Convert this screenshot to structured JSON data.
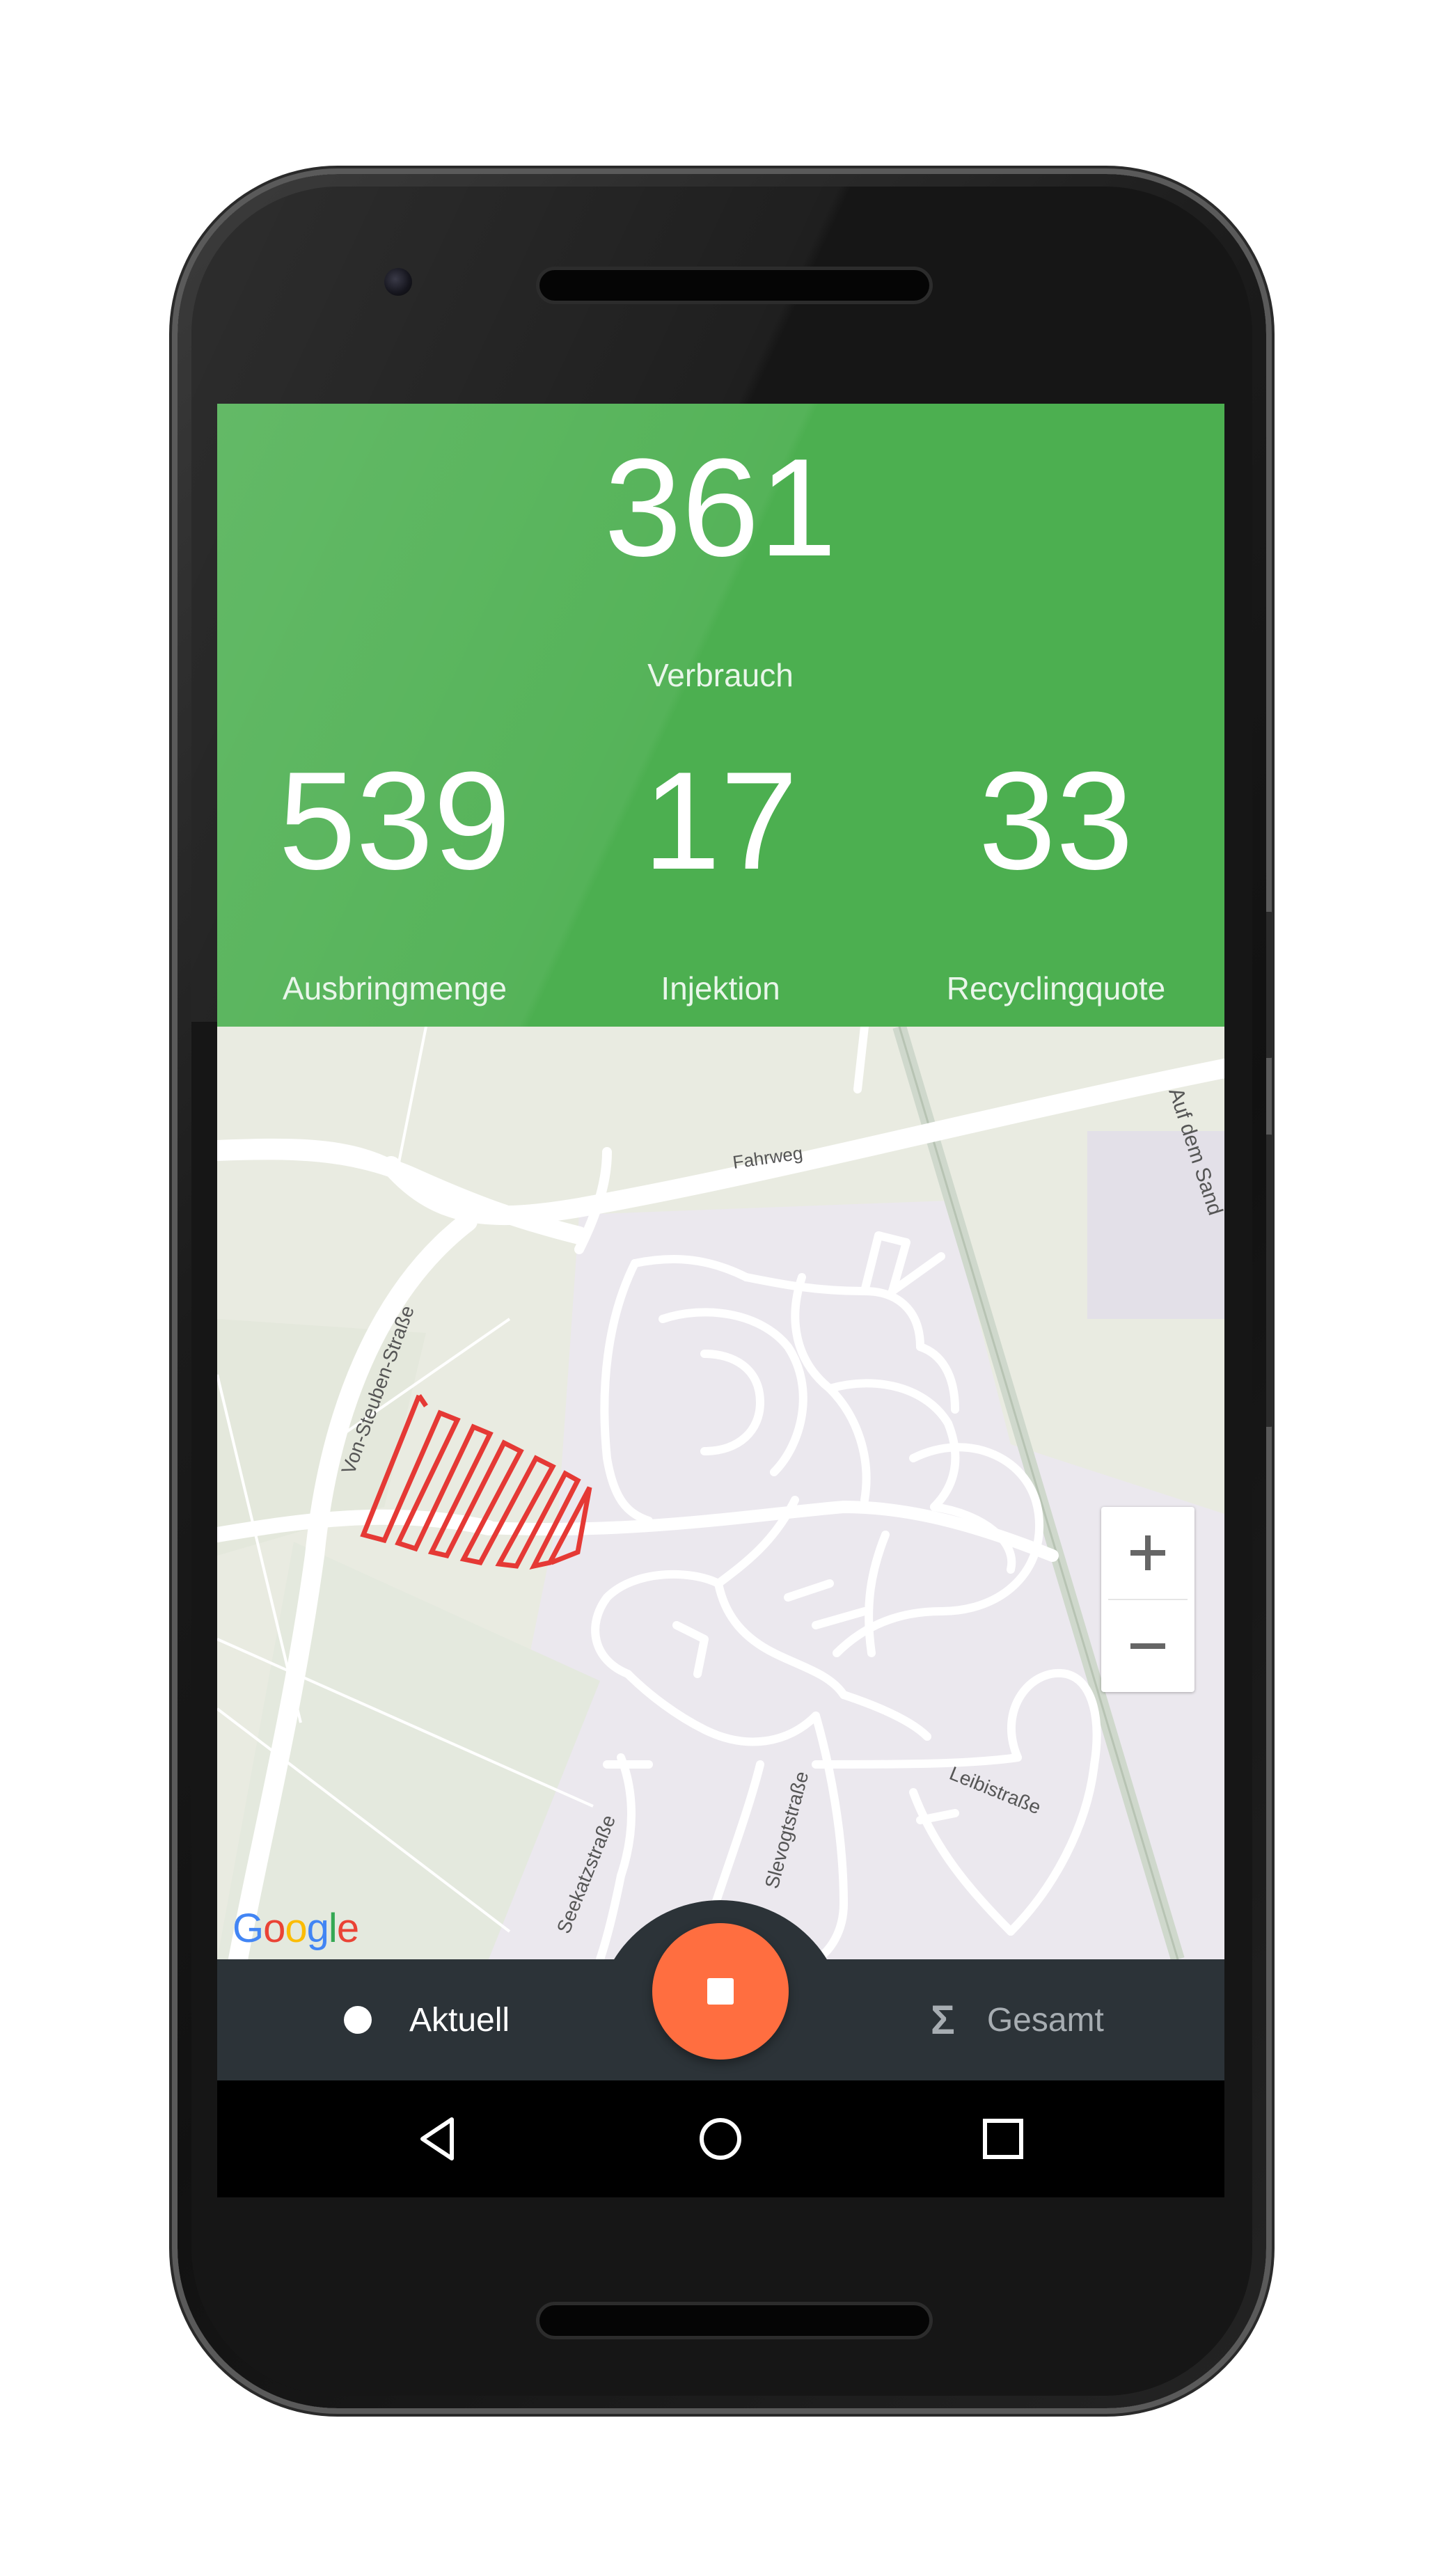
{
  "stats": {
    "main": {
      "value": "361",
      "label": "Verbrauch"
    },
    "items": [
      {
        "value": "539",
        "label": "Ausbringmenge"
      },
      {
        "value": "17",
        "label": "Injektion"
      },
      {
        "value": "33",
        "label": "Recyclingquote"
      }
    ]
  },
  "map": {
    "street_labels": [
      "Fahrweg",
      "Auf dem Sand",
      "Von-Steuben-Straße",
      "Seekatzstraße",
      "Slevogtstraße",
      "Leibistraße"
    ],
    "attribution": "Google",
    "zoom_in_label": "+",
    "zoom_out_label": "−",
    "track_color": "#e53935"
  },
  "bottom_nav": {
    "current_label": "Aktuell",
    "total_label": "Gesamt",
    "fab_icon": "stop-icon",
    "fab_color": "#ff6e40"
  },
  "system_nav": {
    "back_icon": "back-triangle-icon",
    "home_icon": "home-circle-icon",
    "recents_icon": "recents-square-icon"
  },
  "colors": {
    "header_green": "#4caf50",
    "bottom_bar": "#2c3338",
    "map_land": "#e9ebe1",
    "map_residential": "#ebe8ee"
  }
}
